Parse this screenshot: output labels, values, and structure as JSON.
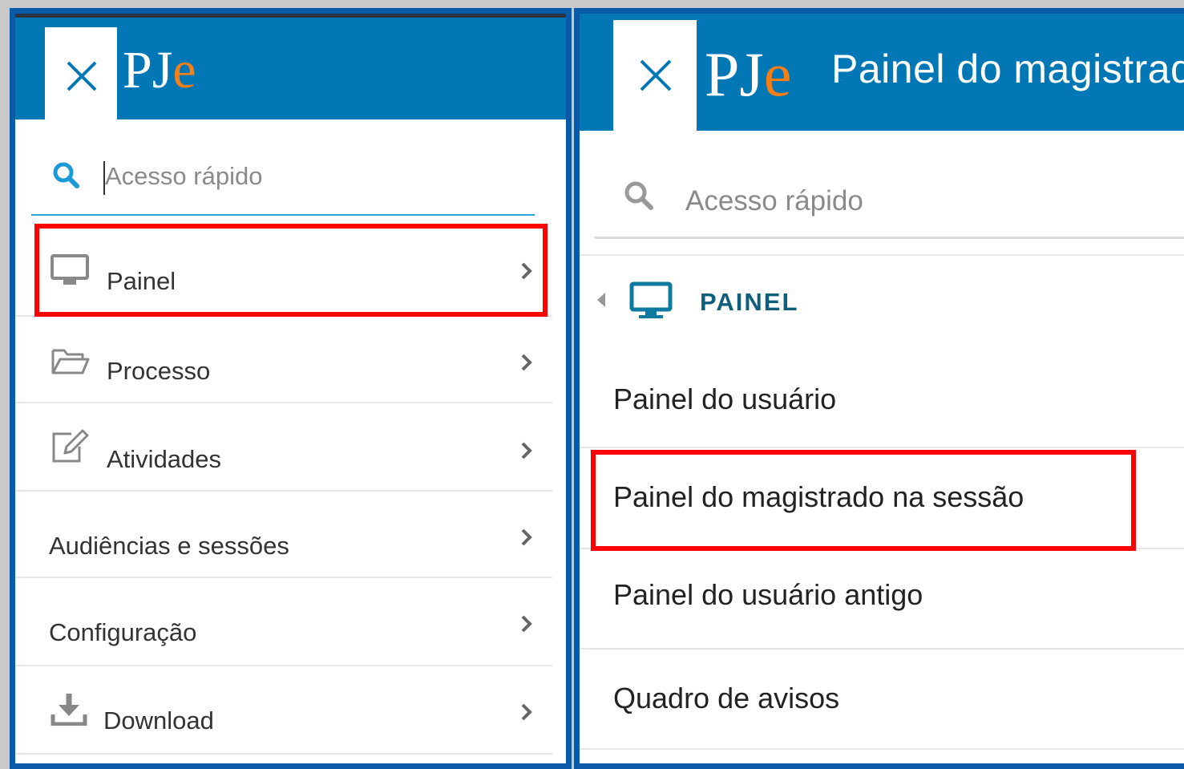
{
  "left": {
    "logo": "PJe",
    "search": {
      "placeholder": "Acesso rápido"
    },
    "menu": [
      {
        "label": "Painel",
        "icon": "monitor-icon"
      },
      {
        "label": "Processo",
        "icon": "folder-open-icon"
      },
      {
        "label": "Atividades",
        "icon": "edit-icon"
      },
      {
        "label": "Audiências e sessões"
      },
      {
        "label": "Configuração"
      },
      {
        "label": "Download",
        "icon": "download-icon"
      }
    ]
  },
  "right": {
    "logo": "PJe",
    "title": "Painel do magistrado",
    "search": {
      "placeholder": "Acesso rápido"
    },
    "section": "PAINEL",
    "items": [
      {
        "label": "Painel do usuário"
      },
      {
        "label": "Painel do magistrado na sessão"
      },
      {
        "label": "Painel do usuário antigo"
      },
      {
        "label": "Quadro de avisos"
      }
    ]
  },
  "colors": {
    "topbar": "#0277b6",
    "border": "#0a5aa8",
    "highlight": "#ff0000",
    "search_accent": "#2aa4d8",
    "logo_accent": "#f57f17",
    "section_title": "#0f5e7a"
  }
}
